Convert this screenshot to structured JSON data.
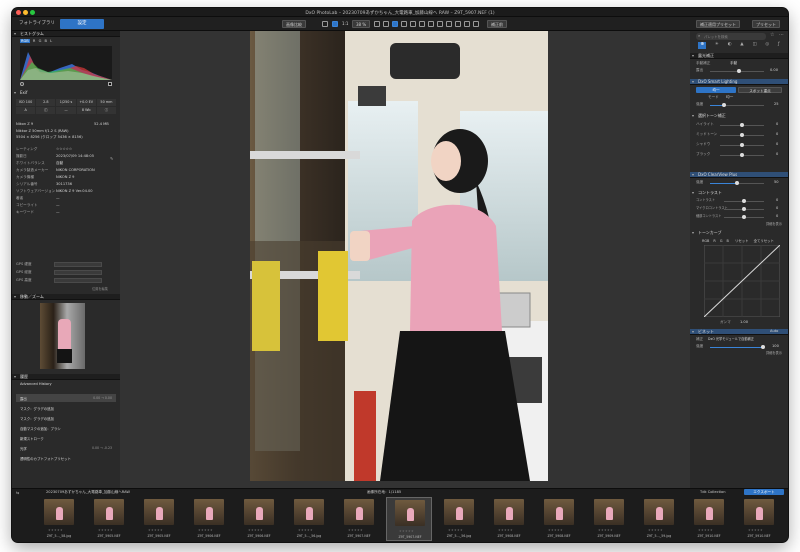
{
  "window": {
    "title": "DxO PhotoLab – 20230709あずかちゃん_大電路車_加藤山線へ RAW – Z9T_5907.NEF (1)",
    "traffic_colors": [
      "#ff5f57",
      "#febc2e",
      "#28c840"
    ]
  },
  "tabs": {
    "library": "フォトライブラリ",
    "customize": "設定"
  },
  "toolbar": {
    "compare": "画像比較",
    "fit": "1:1",
    "zoom": "38 %",
    "before_after": "補正前",
    "presets": "補正適用プリセット",
    "preset_menu": "プリセット"
  },
  "left_panel": {
    "histogram": {
      "title": "ヒストグラム",
      "channels": [
        "RGB",
        "R",
        "G",
        "B",
        "L"
      ]
    },
    "exif": {
      "title": "Exif",
      "cells": [
        "ISO 100",
        "2.8",
        "1/250 s",
        "+0.0 EV",
        "50 mm"
      ],
      "cells2": [
        "A",
        "",
        "",
        "8 Wb",
        ""
      ],
      "camera": "Nikon Z 9",
      "size": "52.4 MB",
      "lens": "Nikkor Z 50mm f/1.2 S (RAW)",
      "dims": "5504 × 8256 (クロップ 5436 × 8156)"
    },
    "metadata": [
      {
        "label": "レーティング",
        "value": "☆☆☆☆☆"
      },
      {
        "label": "撮影日",
        "value": "2023/07/09 14:48:05"
      },
      {
        "label": "ホワイトバランス",
        "value": "自動"
      },
      {
        "label": "カメラ製造メーカー",
        "value": "NIKON CORPORATION"
      },
      {
        "label": "カメラ機種",
        "value": "NIKON Z 9"
      },
      {
        "label": "シリアル番号",
        "value": "3011736"
      },
      {
        "label": "ソフトウェアバージョン",
        "value": "NIKON Z 9 Ver.04.00"
      },
      {
        "label": "著者",
        "value": "—"
      },
      {
        "label": "コピーライト",
        "value": "—"
      },
      {
        "label": "キーワード",
        "value": "—"
      }
    ],
    "gps": [
      {
        "label": "GPS 緯度",
        "value": ""
      },
      {
        "label": "GPS 経度",
        "value": ""
      },
      {
        "label": "GPS 高度",
        "value": ""
      }
    ],
    "gps_link": "位置を編集",
    "navigator_title": "移動／ズーム",
    "history": {
      "title": "履歴",
      "mode": "Advanced History",
      "items": [
        {
          "label": "露出",
          "detail": "0.00 → 0.00",
          "selected": true
        },
        {
          "label": "マスク：グラデの追加",
          "detail": "",
          "selected": false
        },
        {
          "label": "マスク：グラデの追加",
          "detail": "",
          "selected": false
        },
        {
          "label": "自動マスクの追加：ブラシ",
          "detail": "",
          "selected": false
        },
        {
          "label": "新規ストローク",
          "detail": "",
          "selected": false
        },
        {
          "label": "光学",
          "detail": "0.00 → -0.23",
          "selected": false
        },
        {
          "label": "透明性のカプトフォトプリセット",
          "detail": "",
          "selected": false
        }
      ]
    }
  },
  "right_panel": {
    "search_placeholder": "パレットを検索",
    "exposure": {
      "title": "露光補正",
      "mode": "手動",
      "setting_label": "手動補正",
      "param": "露出",
      "value": "0.00"
    },
    "smart_lighting": {
      "title": "DxO Smart Lighting",
      "buttons": [
        "均一",
        "スポット重点"
      ],
      "mode_label": "モード",
      "mode_value": "均一",
      "strength_label": "強度",
      "strength_value": "25"
    },
    "selective_tone": {
      "title": "選択トーン補正",
      "rows": [
        {
          "label": "ハイライト",
          "value": "0"
        },
        {
          "label": "ミッドトーン",
          "value": "0"
        },
        {
          "label": "シャドウ",
          "value": "0"
        },
        {
          "label": "ブラック",
          "value": "0"
        }
      ]
    },
    "clearview": {
      "title": "DxO ClearView Plus",
      "label": "強度",
      "value": "50"
    },
    "contrast": {
      "title": "コントラスト",
      "rows": [
        {
          "label": "コントラスト",
          "value": "0"
        },
        {
          "label": "マイクロコントラスト",
          "value": "0"
        },
        {
          "label": "細部コントラスト",
          "value": "0"
        }
      ],
      "link": "詳細を表示"
    },
    "tone_curve": {
      "title": "トーンカーブ",
      "tabs": [
        "RGB",
        "R",
        "G",
        "B",
        "リセット",
        "全てリセット"
      ],
      "gamma_label": "ガンマ",
      "gamma_value": "1.00"
    },
    "vignette": {
      "title": "ビネット",
      "mode_label": "Auto",
      "preset_label": "補正",
      "preset_value": "DxO 光学モジュールで自動補正",
      "strength_label": "強度",
      "strength_value": "100",
      "link": "詳細を表示"
    }
  },
  "filmstrip": {
    "path": "20230709あずかちゃん_大電路車_加藤山線へRAW",
    "counter": "画像所在地：1/1185",
    "count": "1/1185",
    "collection": "Tdk Collection",
    "export": "エクスポート",
    "thumbs": [
      "Z9T_5…_58.jpg",
      "Z9T_5905.NEF",
      "Z9T_5905.NEF",
      "Z9T_5906.NEF",
      "Z9T_5906.NEF",
      "Z9T_5…_56.jpg",
      "Z9T_5907.NEF",
      "Z9T_5907.NEF",
      "Z9T_5…_56.jpg",
      "Z9T_5908.NEF",
      "Z9T_5908.NEF",
      "Z9T_5909.NEF",
      "Z9T_5…_59.jpg",
      "Z9T_5910.NEF",
      "Z9T_5910.NEF"
    ],
    "selected_index": 7
  }
}
